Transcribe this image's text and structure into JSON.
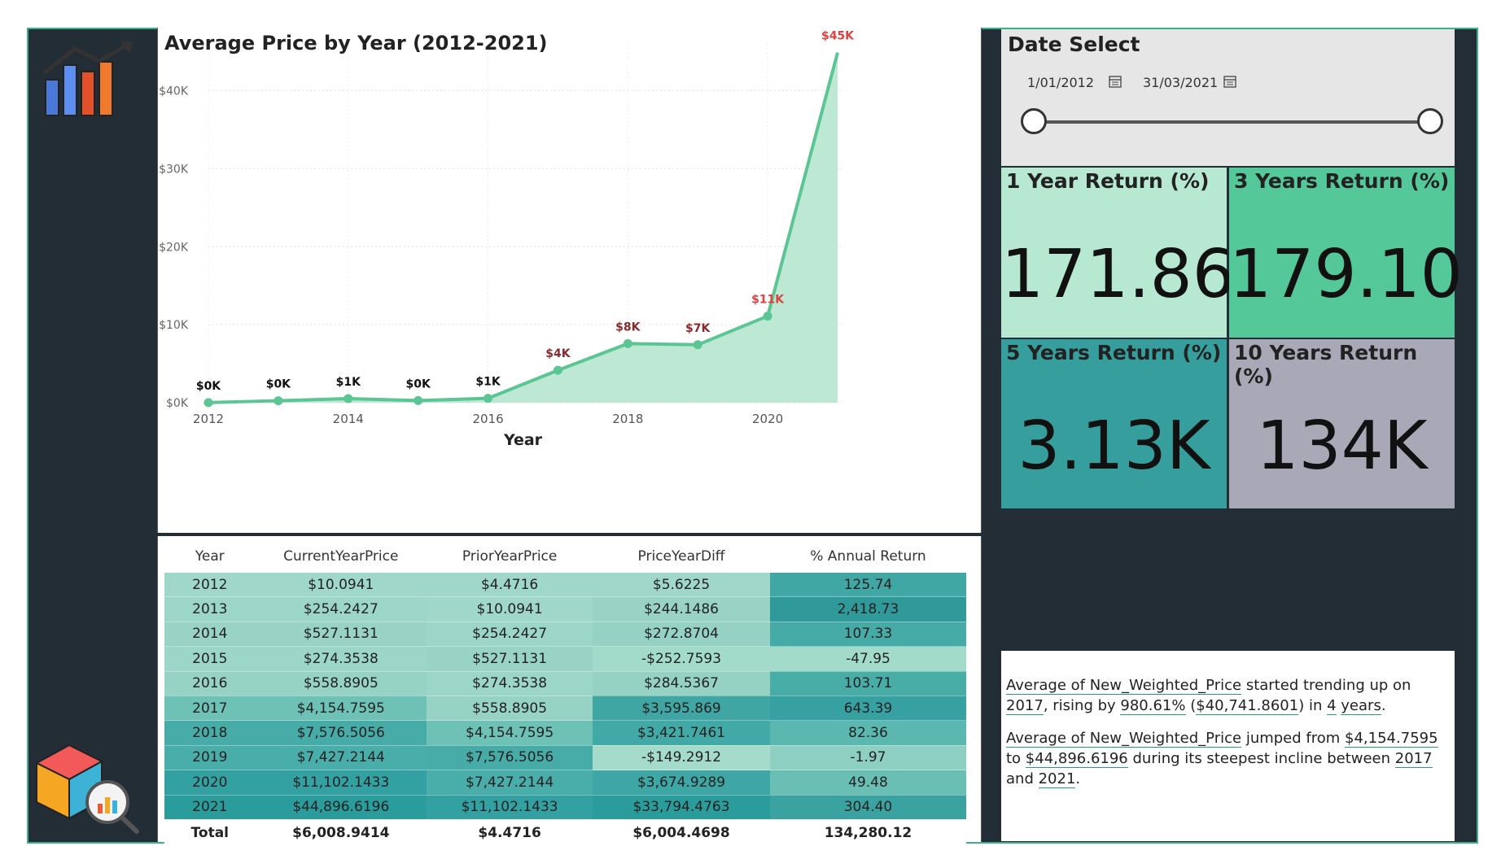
{
  "colors": {
    "background": "#222d36",
    "frame_border": "#3fae8a",
    "line": "#5bc594",
    "area": "#bde9d4",
    "data_label_red": "#d9443f",
    "card_1y": "#b7e8d2",
    "card_3y": "#54c898",
    "card_5y": "#369e9c",
    "card_10y": "#a9a8b6"
  },
  "chart_data": {
    "type": "area",
    "title": "Average Price by Year (2012-2021)",
    "xlabel": "Year",
    "ylabel": "",
    "x": [
      2012,
      2013,
      2014,
      2015,
      2016,
      2017,
      2018,
      2019,
      2020,
      2021
    ],
    "values": [
      10.0941,
      254.2427,
      527.1131,
      274.3538,
      558.8905,
      4154.7595,
      7576.5056,
      7427.2144,
      11102.1433,
      44896.6196
    ],
    "data_labels": [
      "$0K",
      "$0K",
      "$1K",
      "$0K",
      "$1K",
      "$4K",
      "$8K",
      "$7K",
      "$11K",
      "$45K"
    ],
    "x_ticks": [
      "2012",
      "2014",
      "2016",
      "2018",
      "2020"
    ],
    "y_ticks": [
      "$0K",
      "$10K",
      "$20K",
      "$30K",
      "$40K"
    ],
    "y_tick_values": [
      0,
      10000,
      20000,
      30000,
      40000
    ],
    "ylim": [
      0,
      46000
    ],
    "grid": true,
    "legend": "none"
  },
  "table": {
    "headers": [
      "Year",
      "CurrentYearPrice",
      "PriorYearPrice",
      "PriceYearDiff",
      "% Annual Return"
    ],
    "rows": [
      {
        "cells": [
          "2012",
          "$10.0941",
          "$4.4716",
          "$5.6225",
          "125.74"
        ],
        "bg": [
          "#9fd7c8",
          "#9fd7c8",
          "#9fd7c8",
          "#9fd7c8",
          "#41a7a5"
        ]
      },
      {
        "cells": [
          "2013",
          "$254.2427",
          "$10.0941",
          "$244.1486",
          "2,418.73"
        ],
        "bg": [
          "#9bd6c6",
          "#9bd6c6",
          "#9fd7c8",
          "#98d3c4",
          "#30999a"
        ]
      },
      {
        "cells": [
          "2014",
          "$527.1131",
          "$254.2427",
          "$272.8704",
          "107.33"
        ],
        "bg": [
          "#98d3c4",
          "#98d3c4",
          "#9bd6c6",
          "#96d2c4",
          "#46aaa6"
        ]
      },
      {
        "cells": [
          "2015",
          "$274.3538",
          "$527.1131",
          "-$252.7593",
          "-47.95"
        ],
        "bg": [
          "#9bd6c6",
          "#9bd6c6",
          "#98d3c4",
          "#a2dbc9",
          "#a2dbc9"
        ]
      },
      {
        "cells": [
          "2016",
          "$558.8905",
          "$274.3538",
          "$284.5367",
          "103.71"
        ],
        "bg": [
          "#97d3c4",
          "#97d3c4",
          "#9bd6c6",
          "#96d2c4",
          "#48aca7"
        ]
      },
      {
        "cells": [
          "2017",
          "$4,154.7595",
          "$558.8905",
          "$3,595.869",
          "643.39"
        ],
        "bg": [
          "#6ec1b5",
          "#6ec1b5",
          "#97d3c4",
          "#3fa6a3",
          "#37a0a0"
        ]
      },
      {
        "cells": [
          "2018",
          "$7,576.5056",
          "$4,154.7595",
          "$3,421.7461",
          "82.36"
        ],
        "bg": [
          "#47aca8",
          "#47aca8",
          "#6ec1b5",
          "#43a9a6",
          "#5bb8b0"
        ]
      },
      {
        "cells": [
          "2019",
          "$7,427.2144",
          "$7,576.5056",
          "-$149.2912",
          "-1.97"
        ],
        "bg": [
          "#49ada9",
          "#49ada9",
          "#47aca8",
          "#a4dbca",
          "#8dcfc1"
        ]
      },
      {
        "cells": [
          "2020",
          "$11,102.1433",
          "$7,427.2144",
          "$3,674.9289",
          "49.48"
        ],
        "bg": [
          "#33a0a1",
          "#33a0a1",
          "#49ada9",
          "#3ea6a4",
          "#6abfb5"
        ]
      },
      {
        "cells": [
          "2021",
          "$44,896.6196",
          "$11,102.1433",
          "$33,794.4763",
          "304.40"
        ],
        "bg": [
          "#2a9c9c",
          "#2a9c9c",
          "#33a0a1",
          "#2a9c9c",
          "#3aa3a2"
        ]
      }
    ],
    "total": [
      "Total",
      "$6,008.9414",
      "$4.4716",
      "$6,004.4698",
      "134,280.12"
    ]
  },
  "date_select": {
    "title": "Date Select",
    "start": "1/01/2012",
    "end": "31/03/2021",
    "start_icon": "calendar-icon",
    "end_icon": "calendar-icon"
  },
  "cards": {
    "one_year": {
      "title": "1 Year Return (%)",
      "value": "171.86"
    },
    "three_years": {
      "title": "3 Years Return (%)",
      "value": "179.10"
    },
    "five_years": {
      "title": "5 Years Return (%)",
      "value": "3.13K"
    },
    "ten_years": {
      "title": "10 Years Return (%)",
      "value": "134K"
    }
  },
  "insights": {
    "p1": {
      "measure": "Average of New_Weighted_Price",
      "t1": " started trending up on ",
      "year": "2017",
      "t2": ", rising by ",
      "pct": "980.61%",
      "t3": " (",
      "amount": "$40,741.8601",
      "t4": ") in ",
      "years": "4",
      "t5": " ",
      "years_unit": "years",
      "t6": "."
    },
    "p2": {
      "measure": "Average of New_Weighted_Price",
      "t1": " jumped from ",
      "from": "$4,154.7595",
      "t2": " to ",
      "to": "$44,896.6196",
      "t3": " during its steepest incline between ",
      "start": "2017",
      "t4": " and ",
      "end": "2021",
      "t5": "."
    }
  },
  "logos": {
    "top": "bar-chart-logo-icon",
    "bottom": "data-cube-magnifier-icon"
  }
}
